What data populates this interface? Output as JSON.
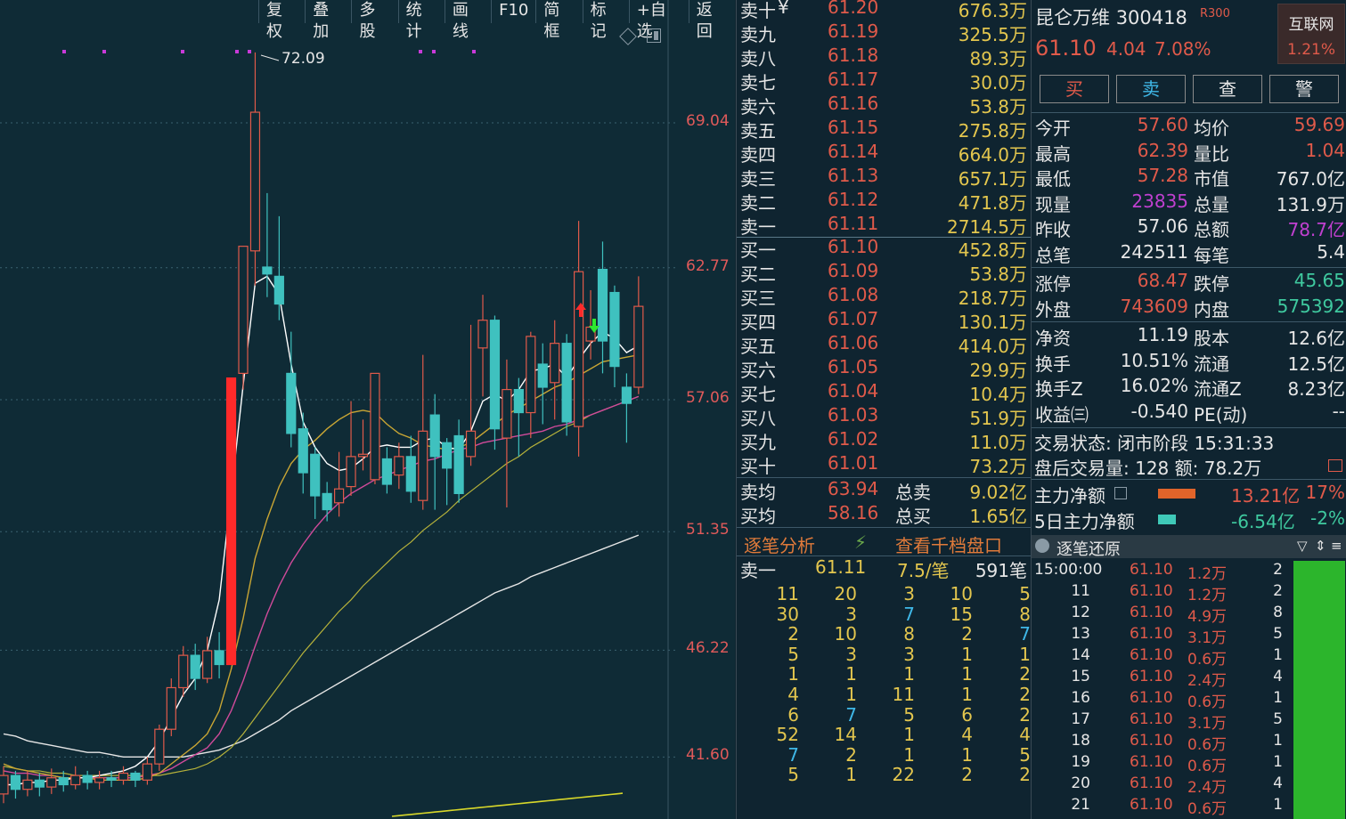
{
  "toolbar": [
    "复权",
    "叠加",
    "多股",
    "统计",
    "画线",
    "F10",
    "简框",
    "标记",
    "+自选",
    "返回"
  ],
  "chart": {
    "price_labels": [
      "69.04",
      "62.77",
      "57.06",
      "51.35",
      "46.22",
      "41.60"
    ],
    "peak_label": "72.09"
  },
  "chart_data": {
    "type": "candlestick",
    "price_levels": [
      69.04,
      62.77,
      57.06,
      51.35,
      46.22,
      41.6
    ],
    "candles": [
      [
        40.0,
        40.8,
        41.2,
        39.6
      ],
      [
        40.8,
        40.2,
        41.0,
        39.8
      ],
      [
        40.2,
        40.6,
        41.0,
        39.9
      ],
      [
        40.6,
        40.3,
        40.9,
        39.9
      ],
      [
        40.3,
        40.7,
        41.1,
        40.0
      ],
      [
        40.7,
        40.4,
        41.0,
        40.1
      ],
      [
        40.4,
        40.8,
        41.2,
        40.2
      ],
      [
        40.8,
        40.5,
        41.0,
        40.2
      ],
      [
        40.5,
        40.7,
        41.0,
        40.2
      ],
      [
        40.7,
        40.6,
        41.0,
        40.3
      ],
      [
        40.6,
        40.9,
        41.2,
        40.4
      ],
      [
        40.9,
        40.6,
        41.0,
        40.3
      ],
      [
        40.6,
        41.3,
        41.6,
        40.4
      ],
      [
        41.3,
        42.8,
        43.0,
        41.0
      ],
      [
        42.8,
        44.6,
        45.0,
        42.5
      ],
      [
        44.6,
        46.0,
        46.4,
        44.2
      ],
      [
        46.0,
        45.0,
        46.5,
        44.5
      ],
      [
        45.0,
        46.2,
        46.8,
        44.8
      ],
      [
        46.2,
        45.6,
        47.0,
        45.0
      ],
      [
        45.6,
        58.0,
        58.0,
        45.6
      ],
      [
        58.2,
        63.7,
        63.7,
        57.5
      ],
      [
        63.5,
        69.5,
        72.09,
        62.0
      ],
      [
        62.8,
        62.5,
        66.0,
        61.5
      ],
      [
        62.4,
        61.2,
        65.0,
        60.5
      ],
      [
        58.2,
        55.6,
        60.0,
        55.0
      ],
      [
        55.8,
        53.9,
        56.5,
        53.0
      ],
      [
        54.7,
        52.9,
        55.0,
        51.9
      ],
      [
        53.0,
        52.3,
        53.5,
        51.8
      ],
      [
        52.6,
        53.2,
        54.8,
        52.0
      ],
      [
        53.3,
        54.6,
        57.0,
        52.9
      ],
      [
        54.6,
        54.7,
        56.2,
        54.0
      ],
      [
        53.6,
        58.2,
        58.2,
        53.4
      ],
      [
        54.5,
        53.4,
        55.0,
        53.0
      ],
      [
        53.8,
        54.6,
        55.2,
        53.2
      ],
      [
        54.6,
        53.1,
        55.5,
        52.6
      ],
      [
        52.7,
        55.7,
        59.0,
        52.3
      ],
      [
        56.4,
        54.6,
        57.3,
        52.3
      ],
      [
        55.2,
        54.1,
        55.4,
        52.5
      ],
      [
        55.5,
        53.0,
        56.2,
        52.6
      ],
      [
        54.6,
        55.7,
        60.3,
        54.2
      ],
      [
        59.3,
        60.5,
        61.6,
        57.2
      ],
      [
        60.5,
        55.8,
        60.7,
        54.9
      ],
      [
        55.4,
        57.5,
        58.8,
        52.4
      ],
      [
        57.5,
        56.5,
        58.0,
        54.6
      ],
      [
        56.5,
        59.8,
        60.0,
        55.4
      ],
      [
        58.6,
        57.6,
        59.5,
        56.0
      ],
      [
        57.8,
        59.5,
        60.5,
        56.2
      ],
      [
        59.5,
        56.1,
        59.9,
        55.5
      ],
      [
        55.9,
        62.6,
        64.8,
        54.6
      ],
      [
        59.6,
        60.2,
        61.8,
        58.8
      ],
      [
        62.7,
        59.6,
        63.9,
        58.2
      ],
      [
        61.7,
        58.5,
        62.0,
        57.6
      ],
      [
        57.6,
        56.9,
        58.2,
        55.2
      ],
      [
        57.6,
        61.1,
        62.4,
        57.3
      ]
    ],
    "ma_white_short": [
      40.4,
      40.4,
      40.5,
      40.5,
      40.6,
      40.6,
      40.7,
      40.7,
      40.8,
      40.9,
      41.0,
      41.2,
      41.6,
      42.3,
      43.3,
      44.3,
      45.0,
      46.2,
      48.4,
      53.0,
      57.7,
      62.1,
      62.4,
      61.6,
      58.6,
      56.1,
      55.0,
      54.3,
      54.0,
      54.1,
      54.5,
      55.0,
      55.1,
      55.0,
      55.0,
      55.3,
      55.4,
      55.0,
      54.9,
      55.7,
      57.0,
      57.3,
      57.0,
      57.5,
      58.3,
      58.4,
      58.6,
      58.0,
      58.8,
      59.5,
      60.0,
      59.7,
      59.1,
      59.4
    ],
    "ma_yellow": [
      41.3,
      41.1,
      41.0,
      40.9,
      40.8,
      40.7,
      40.7,
      40.7,
      40.6,
      40.6,
      40.6,
      40.6,
      40.7,
      40.9,
      41.3,
      41.7,
      42.1,
      42.6,
      43.6,
      45.4,
      47.6,
      50.2,
      51.9,
      53.3,
      54.3,
      54.9,
      55.3,
      55.8,
      56.2,
      56.5,
      56.6,
      56.5,
      56.0,
      55.6,
      55.4,
      55.1,
      55.0,
      54.9,
      55.0,
      55.2,
      55.6,
      56.0,
      56.4,
      56.7,
      57.0,
      57.3,
      57.6,
      57.8,
      58.1,
      58.4,
      58.7,
      58.8,
      58.9,
      59.0
    ],
    "ma_pink": [
      41.0,
      40.9,
      40.9,
      40.8,
      40.8,
      40.7,
      40.7,
      40.7,
      40.7,
      40.7,
      40.7,
      40.7,
      40.8,
      40.9,
      41.1,
      41.4,
      41.7,
      42.0,
      42.6,
      43.6,
      44.9,
      46.4,
      47.8,
      49.0,
      50.0,
      50.8,
      51.5,
      52.1,
      52.6,
      53.0,
      53.3,
      53.6,
      53.8,
      54.0,
      54.2,
      54.4,
      54.5,
      54.7,
      54.9,
      55.0,
      55.2,
      55.3,
      55.4,
      55.5,
      55.6,
      55.7,
      55.9,
      56.0,
      56.2,
      56.4,
      56.6,
      56.8,
      57.0,
      57.2
    ],
    "ma_olive": [
      41.2,
      41.1,
      41.0,
      41.0,
      40.9,
      40.9,
      40.8,
      40.8,
      40.8,
      40.8,
      40.8,
      40.8,
      40.8,
      40.8,
      40.9,
      41.0,
      41.1,
      41.3,
      41.6,
      42.0,
      42.6,
      43.3,
      44.0,
      44.7,
      45.4,
      46.1,
      46.7,
      47.3,
      47.9,
      48.4,
      49.0,
      49.5,
      50.0,
      50.5,
      50.9,
      51.4,
      51.8,
      52.2,
      52.7,
      53.1,
      53.5,
      53.9,
      54.3,
      54.6,
      55.0,
      55.3,
      55.6,
      55.9,
      56.1,
      56.4,
      56.6,
      56.8,
      57.0,
      57.2
    ],
    "ma_white_long": [
      42.6,
      42.5,
      42.3,
      42.2,
      42.1,
      42.0,
      41.9,
      41.8,
      41.8,
      41.7,
      41.6,
      41.6,
      41.6,
      41.6,
      41.6,
      41.6,
      41.7,
      41.8,
      41.9,
      42.1,
      42.3,
      42.6,
      42.9,
      43.2,
      43.6,
      43.9,
      44.2,
      44.5,
      44.8,
      45.1,
      45.4,
      45.7,
      46.0,
      46.3,
      46.6,
      46.9,
      47.2,
      47.5,
      47.8,
      48.1,
      48.4,
      48.7,
      48.9,
      49.1,
      49.4,
      49.6,
      49.8,
      50.0,
      50.2,
      50.4,
      50.6,
      50.8,
      51.0,
      51.2
    ],
    "ma_yellow_long": [
      37.5,
      37.6,
      37.7,
      37.8,
      37.9,
      38.0,
      38.1,
      38.2,
      38.3,
      38.4,
      38.5,
      38.6,
      38.7,
      38.8,
      38.9,
      39.0,
      39.1,
      39.2,
      39.3,
      39.4,
      39.5,
      39.6,
      39.7,
      39.8,
      39.9,
      40.0,
      40.1,
      40.2,
      40.3,
      40.4,
      40.5,
      40.6,
      40.7,
      40.8,
      40.9,
      41.0,
      41.1,
      41.2
    ]
  },
  "orderbook": {
    "sell": [
      {
        "label": "卖十",
        "price": "61.20",
        "vol": "676.3万",
        "mark": "¥"
      },
      {
        "label": "卖九",
        "price": "61.19",
        "vol": "325.5万"
      },
      {
        "label": "卖八",
        "price": "61.18",
        "vol": "89.3万"
      },
      {
        "label": "卖七",
        "price": "61.17",
        "vol": "30.0万"
      },
      {
        "label": "卖六",
        "price": "61.16",
        "vol": "53.8万"
      },
      {
        "label": "卖五",
        "price": "61.15",
        "vol": "275.8万"
      },
      {
        "label": "卖四",
        "price": "61.14",
        "vol": "664.0万"
      },
      {
        "label": "卖三",
        "price": "61.13",
        "vol": "657.1万"
      },
      {
        "label": "卖二",
        "price": "61.12",
        "vol": "471.8万"
      },
      {
        "label": "卖一",
        "price": "61.11",
        "vol": "2714.5万"
      }
    ],
    "buy": [
      {
        "label": "买一",
        "price": "61.10",
        "vol": "452.8万"
      },
      {
        "label": "买二",
        "price": "61.09",
        "vol": "53.8万"
      },
      {
        "label": "买三",
        "price": "61.08",
        "vol": "218.7万"
      },
      {
        "label": "买四",
        "price": "61.07",
        "vol": "130.1万"
      },
      {
        "label": "买五",
        "price": "61.06",
        "vol": "414.0万"
      },
      {
        "label": "买六",
        "price": "61.05",
        "vol": "29.9万"
      },
      {
        "label": "买七",
        "price": "61.04",
        "vol": "10.4万"
      },
      {
        "label": "买八",
        "price": "61.03",
        "vol": "51.9万"
      },
      {
        "label": "买九",
        "price": "61.02",
        "vol": "11.0万"
      },
      {
        "label": "买十",
        "price": "61.01",
        "vol": "73.2万"
      }
    ],
    "avg": [
      {
        "label": "卖均",
        "price": "63.94",
        "k": "总卖",
        "v": "9.02亿"
      },
      {
        "label": "买均",
        "price": "58.16",
        "k": "总买",
        "v": "1.65亿"
      }
    ],
    "tab_left": "逐笔分析",
    "tab_right": "查看千档盘口",
    "ticker": {
      "label": "卖一",
      "price": "61.11",
      "avg": "7.5/笔",
      "count": "591笔"
    },
    "grid": [
      [
        "11",
        "20",
        "3",
        "10",
        "5"
      ],
      [
        "30",
        "3",
        "7",
        "15",
        "8"
      ],
      [
        "2",
        "10",
        "8",
        "2",
        "7"
      ],
      [
        "5",
        "3",
        "3",
        "1",
        "1"
      ],
      [
        "1",
        "1",
        "1",
        "1",
        "2"
      ],
      [
        "4",
        "1",
        "11",
        "1",
        "2"
      ],
      [
        "6",
        "7",
        "5",
        "6",
        "2"
      ],
      [
        "52",
        "14",
        "1",
        "4",
        "4"
      ],
      [
        "7",
        "2",
        "1",
        "1",
        "5"
      ],
      [
        "5",
        "1",
        "22",
        "2",
        "2"
      ]
    ]
  },
  "stock": {
    "name": "昆仑万维",
    "code": "300418",
    "badge": "R300",
    "price": "61.10",
    "change": "4.04",
    "pct": "7.08%",
    "sector": "互联网",
    "sector_pct": "1.21%",
    "buttons": [
      "买",
      "卖",
      "查",
      "警"
    ]
  },
  "stats": [
    {
      "k1": "今开",
      "v1": "57.60",
      "c1": "red",
      "k2": "均价",
      "v2": "59.69",
      "c2": "red"
    },
    {
      "k1": "最高",
      "v1": "62.39",
      "c1": "red",
      "k2": "量比",
      "v2": "1.04",
      "c2": "red"
    },
    {
      "k1": "最低",
      "v1": "57.28",
      "c1": "red",
      "k2": "市值",
      "v2": "767.0亿",
      "c2": "white"
    },
    {
      "k1": "现量",
      "v1": "23835",
      "c1": "purple",
      "k2": "总量",
      "v2": "131.9万",
      "c2": "white"
    },
    {
      "k1": "昨收",
      "v1": "57.06",
      "c1": "white",
      "k2": "总额",
      "v2": "78.7亿",
      "c2": "purple"
    },
    {
      "k1": "总笔",
      "v1": "242511",
      "c1": "white",
      "k2": "每笔",
      "v2": "5.4",
      "c2": "white"
    },
    {
      "k1": "涨停",
      "v1": "68.47",
      "c1": "red",
      "k2": "跌停",
      "v2": "45.65",
      "c2": "green"
    },
    {
      "k1": "外盘",
      "v1": "743609",
      "c1": "red",
      "k2": "内盘",
      "v2": "575392",
      "c2": "green"
    },
    {
      "k1": "净资",
      "v1": "11.19",
      "c1": "white",
      "k2": "股本",
      "v2": "12.6亿",
      "c2": "white"
    },
    {
      "k1": "换手",
      "v1": "10.51%",
      "c1": "white",
      "k2": "流通",
      "v2": "12.5亿",
      "c2": "white"
    },
    {
      "k1": "换手Z",
      "v1": "16.02%",
      "c1": "white",
      "k2": "流通Z",
      "v2": "8.23亿",
      "c2": "white"
    },
    {
      "k1": "收益㈢",
      "v1": "-0.540",
      "c1": "white",
      "k2": "PE(动)",
      "v2": "--",
      "c2": "white"
    }
  ],
  "status": {
    "state": "交易状态: 闭市阶段 15:31:33",
    "after": "盘后交易量: 128  额: 78.2万"
  },
  "flows": [
    {
      "k": "主力净额",
      "v": "13.21亿",
      "p": "17%"
    },
    {
      "k": "5日主力净额",
      "v": "-6.54亿",
      "p": "-2%"
    }
  ],
  "trades_title": "逐笔还原",
  "trades": [
    {
      "t": "15:00:00",
      "p": "61.10",
      "v": "1.2万",
      "n": "2"
    },
    {
      "t": "11",
      "p": "61.10",
      "v": "1.2万",
      "n": "2"
    },
    {
      "t": "12",
      "p": "61.10",
      "v": "4.9万",
      "n": "8"
    },
    {
      "t": "13",
      "p": "61.10",
      "v": "3.1万",
      "n": "5"
    },
    {
      "t": "14",
      "p": "61.10",
      "v": "0.6万",
      "n": "1"
    },
    {
      "t": "15",
      "p": "61.10",
      "v": "2.4万",
      "n": "4"
    },
    {
      "t": "16",
      "p": "61.10",
      "v": "0.6万",
      "n": "1"
    },
    {
      "t": "17",
      "p": "61.10",
      "v": "3.1万",
      "n": "5"
    },
    {
      "t": "18",
      "p": "61.10",
      "v": "0.6万",
      "n": "1"
    },
    {
      "t": "19",
      "p": "61.10",
      "v": "0.6万",
      "n": "1"
    },
    {
      "t": "20",
      "p": "61.10",
      "v": "2.4万",
      "n": "4"
    },
    {
      "t": "21",
      "p": "61.10",
      "v": "0.6万",
      "n": "1"
    }
  ]
}
